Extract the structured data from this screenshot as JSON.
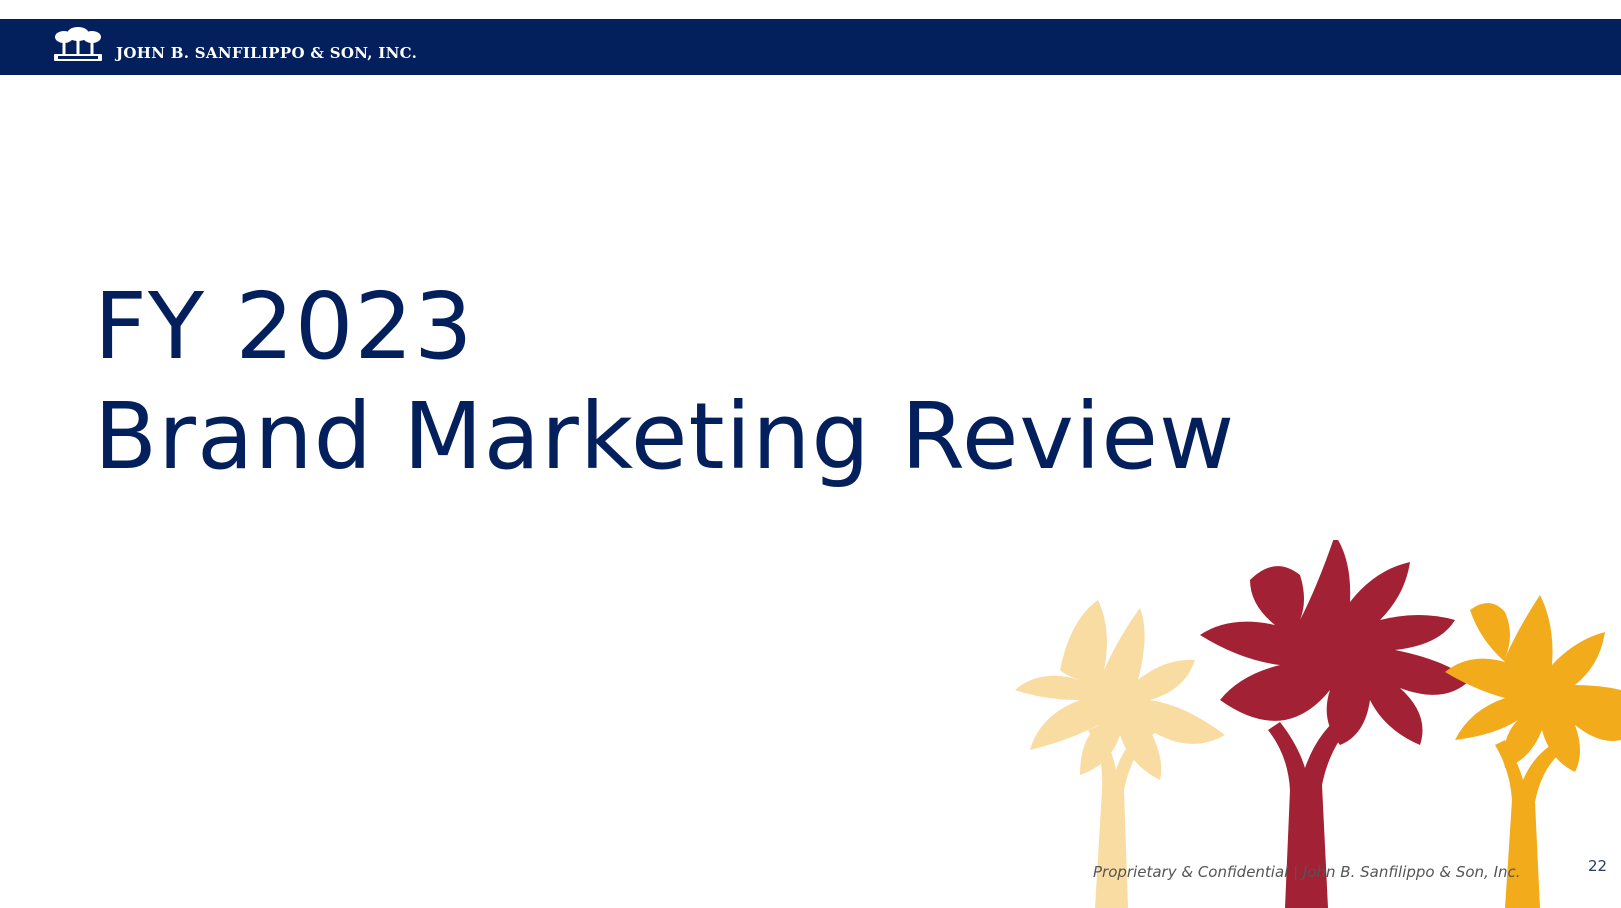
{
  "header": {
    "company_name": "JOHN B. SANFILIPPO & SON, INC.",
    "logo_icon": "palm-trees-logo-icon",
    "bar_color": "#03205c"
  },
  "slide": {
    "title_line_1": "FY 2023",
    "title_line_2": "Brand Marketing Review",
    "title_color": "#03205c"
  },
  "decoration": {
    "icon": "trees-illustration-icon",
    "colors": [
      "#f9dca1",
      "#a32135",
      "#f2ab1b"
    ]
  },
  "footer": {
    "confidential_text": "Proprietary & Confidential | John B. Sanfilippo & Son, Inc.",
    "page_number": "22"
  }
}
